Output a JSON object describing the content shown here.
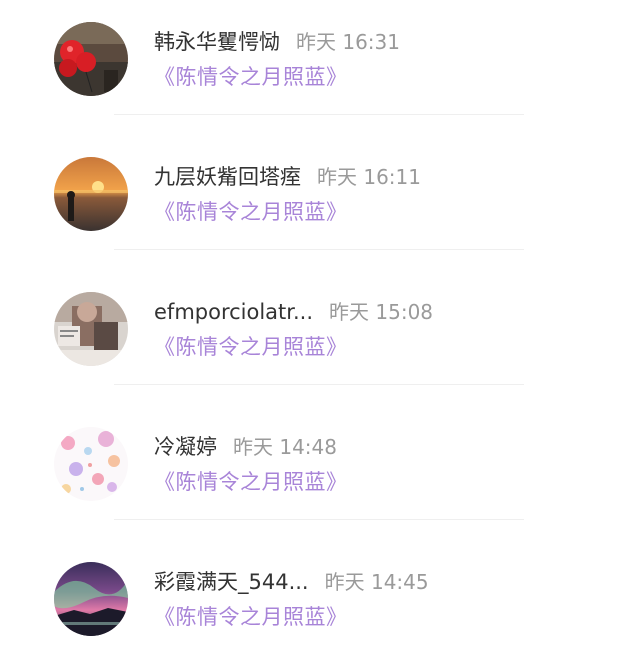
{
  "comments": [
    {
      "name": "韩永华矍愕恸",
      "time": "昨天 16:31",
      "quote": "《陈情令之月照蓝》",
      "avatar_icon": "red-balloons-avatar"
    },
    {
      "name": "九层妖觜回塔痓",
      "time": "昨天 16:11",
      "quote": "《陈情令之月照蓝》",
      "avatar_icon": "sunset-silhouette-avatar"
    },
    {
      "name": "efmporciolatr...",
      "time": "昨天 15:08",
      "quote": "《陈情令之月照蓝》",
      "avatar_icon": "photo-collage-avatar"
    },
    {
      "name": "冷凝婷",
      "time": "昨天 14:48",
      "quote": "《陈情令之月照蓝》",
      "avatar_icon": "floral-pattern-avatar"
    },
    {
      "name": "彩霞满天_544...",
      "time": "昨天 14:45",
      "quote": "《陈情令之月照蓝》",
      "avatar_icon": "aurora-landscape-avatar"
    }
  ],
  "colors": {
    "name": "#333333",
    "time": "#9a9a9a",
    "quote": "#a884d8",
    "divider": "#efefef"
  }
}
